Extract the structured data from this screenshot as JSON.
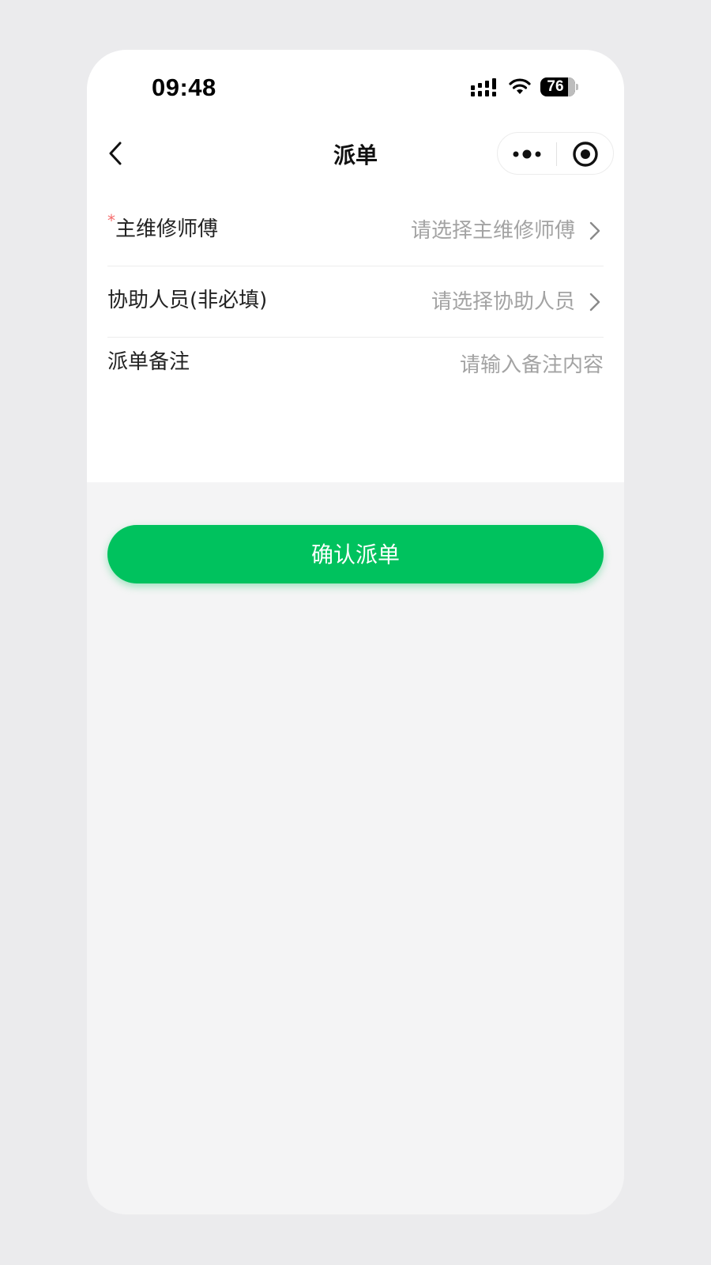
{
  "status_bar": {
    "time": "09:48",
    "battery_level": "76",
    "icons": [
      "signal-icon",
      "wifi-icon",
      "battery-icon"
    ]
  },
  "nav_bar": {
    "title": "派单",
    "icons": [
      "back-icon",
      "more-icon",
      "record-target-icon"
    ]
  },
  "form": {
    "main_technician": {
      "required_mark": "*",
      "label": "主维修师傅",
      "placeholder": "请选择主维修师傅"
    },
    "assistants": {
      "label": "协助人员(非必填)",
      "placeholder": "请选择协助人员"
    },
    "remark": {
      "label": "派单备注",
      "value": "",
      "placeholder": "请输入备注内容"
    }
  },
  "actions": {
    "confirm_label": "确认派单"
  },
  "colors": {
    "primary": "#00c25e",
    "required": "#f56c6c",
    "placeholder": "#a3a3a3",
    "background": "#f4f4f5"
  }
}
